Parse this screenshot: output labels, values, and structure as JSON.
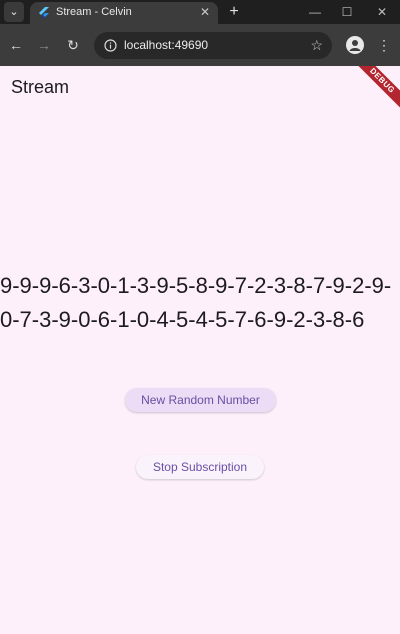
{
  "browser": {
    "tab_menu_icon": "chevron-down-icon",
    "tab": {
      "title": "Stream - Celvin",
      "favicon": "flutter-icon",
      "close_icon": "close-icon"
    },
    "new_tab_icon": "plus-icon",
    "window_controls": [
      "minimize-icon",
      "maximize-icon",
      "close-icon"
    ],
    "toolbar": {
      "back_icon": "arrow-left-icon",
      "forward_icon": "arrow-right-icon",
      "reload_icon": "reload-icon",
      "site_info_icon": "info-icon",
      "url": "localhost:49690",
      "bookmark_icon": "star-icon",
      "profile_icon": "person-icon",
      "menu_icon": "kebab-menu-icon"
    }
  },
  "app": {
    "title": "Stream",
    "debug_banner": "DEBUG",
    "stream_digits": "9-9-9-6-3-0-1-3-9-5-8-9-7-2-3-8-7-9-2-9-0-7-3-9-0-6-1-0-4-5-4-5-7-6-9-2-3-8-6",
    "buttons": {
      "new_random": "New Random Number",
      "stop_subscription": "Stop Subscription"
    }
  },
  "colors": {
    "background": "#fdf0fb",
    "primary_text": "#1d1b20",
    "button_text": "#6750a4",
    "primary_button_bg": "#ecdcf5",
    "debug_banner": "#b3262f",
    "chrome_dark": "#1f1f1f",
    "toolbar": "#3c3c3c"
  }
}
